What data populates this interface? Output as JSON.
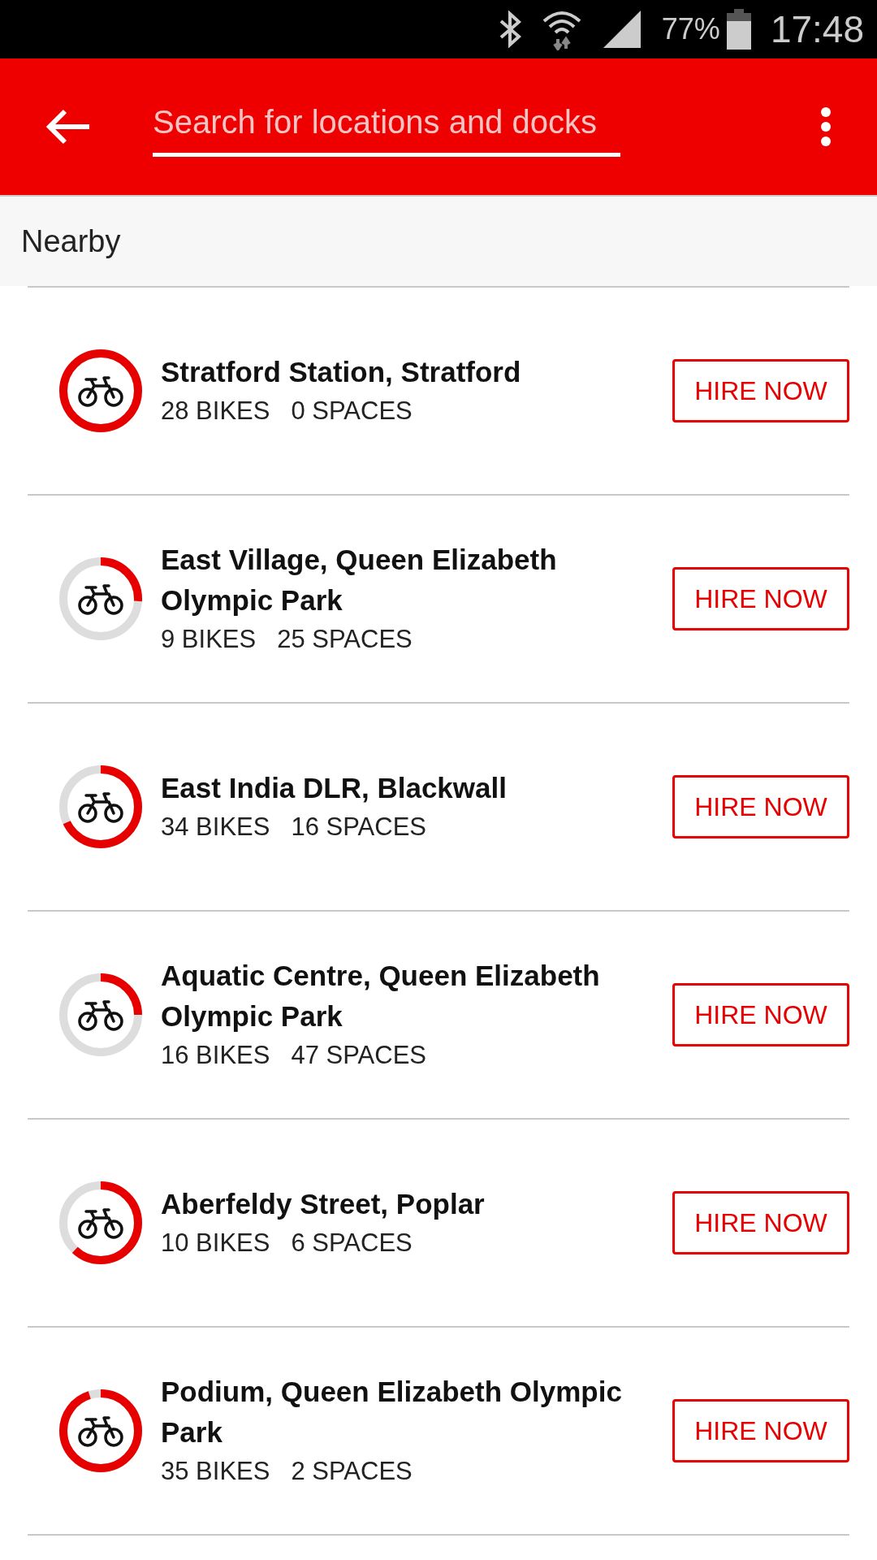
{
  "status_bar": {
    "battery": "77%",
    "time": "17:48"
  },
  "search": {
    "placeholder": "Search for locations and docks"
  },
  "section": {
    "title": "Nearby"
  },
  "docks": [
    {
      "name": "Stratford Station, Stratford",
      "bikes": "28 BIKES",
      "spaces": "0 SPACES",
      "level": 1,
      "button": "HIRE NOW"
    },
    {
      "name": "East Village, Queen Elizabeth Olympic Park",
      "bikes": "9 BIKES",
      "spaces": "25 SPACES",
      "level": 0.26,
      "button": "HIRE NOW"
    },
    {
      "name": "East India DLR, Blackwall",
      "bikes": "34 BIKES",
      "spaces": "16 SPACES",
      "level": 0.68,
      "button": "HIRE NOW"
    },
    {
      "name": "Aquatic Centre, Queen Elizabeth Olympic Park",
      "bikes": "16 BIKES",
      "spaces": "47 SPACES",
      "level": 0.25,
      "button": "HIRE NOW"
    },
    {
      "name": "Aberfeldy Street, Poplar",
      "bikes": "10 BIKES",
      "spaces": "6 SPACES",
      "level": 0.62,
      "button": "HIRE NOW"
    },
    {
      "name": "Podium, Queen Elizabeth Olympic Park",
      "bikes": "35 BIKES",
      "spaces": "2 SPACES",
      "level": 0.95,
      "button": "HIRE NOW"
    }
  ]
}
